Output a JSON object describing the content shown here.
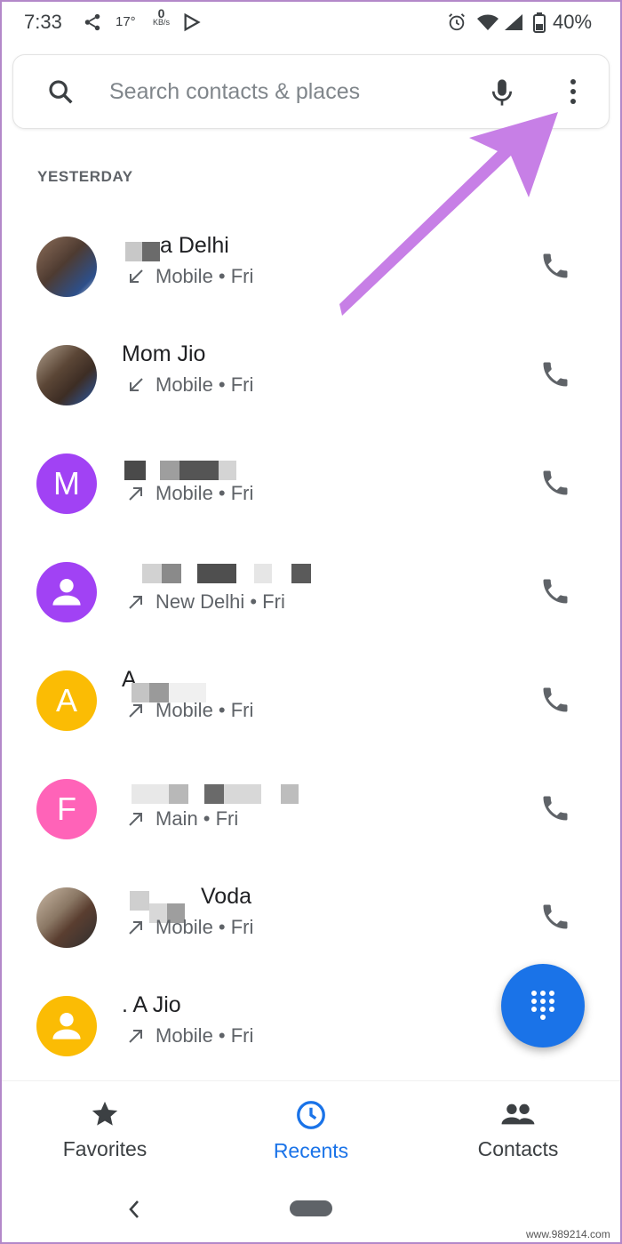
{
  "status_bar": {
    "time": "7:33",
    "temperature": "17°",
    "speed_value": "0",
    "speed_unit": "KB/s",
    "battery": "40%"
  },
  "search": {
    "placeholder": "Search contacts & places"
  },
  "section_title": "YESTERDAY",
  "calls": [
    {
      "name": "a Delhi",
      "direction": "incoming",
      "subtitle": "Mobile • Fri",
      "avatar_letter": "",
      "avatar_color": "#6d6d6d"
    },
    {
      "name": "Mom Jio",
      "direction": "incoming",
      "subtitle": "Mobile • Fri",
      "avatar_letter": "",
      "avatar_color": "#7a6b5c"
    },
    {
      "name": "",
      "direction": "outgoing",
      "subtitle": "Mobile • Fri",
      "avatar_letter": "M",
      "avatar_color": "#a142f4"
    },
    {
      "name": "",
      "direction": "outgoing",
      "subtitle": "New Delhi • Fri",
      "avatar_letter": "",
      "avatar_color": "#a142f4"
    },
    {
      "name": "A",
      "direction": "outgoing",
      "subtitle": "Mobile • Fri",
      "avatar_letter": "A",
      "avatar_color": "#fbbc04"
    },
    {
      "name": "",
      "direction": "outgoing",
      "subtitle": "Main • Fri",
      "avatar_letter": "F",
      "avatar_color": "#ff63b8"
    },
    {
      "name": "Voda",
      "direction": "outgoing",
      "subtitle": "Mobile • Fri",
      "avatar_letter": "",
      "avatar_color": "#8a7f73"
    },
    {
      "name": ". A Jio",
      "direction": "outgoing",
      "subtitle": "Mobile • Fri",
      "avatar_letter": "",
      "avatar_color": "#fbbc04"
    }
  ],
  "bottom_nav": {
    "favorites": "Favorites",
    "recents": "Recents",
    "contacts": "Contacts"
  },
  "colors": {
    "accent": "#1a73e8",
    "annotation_arrow": "#c77fe6"
  },
  "watermark": "www.989214.com"
}
